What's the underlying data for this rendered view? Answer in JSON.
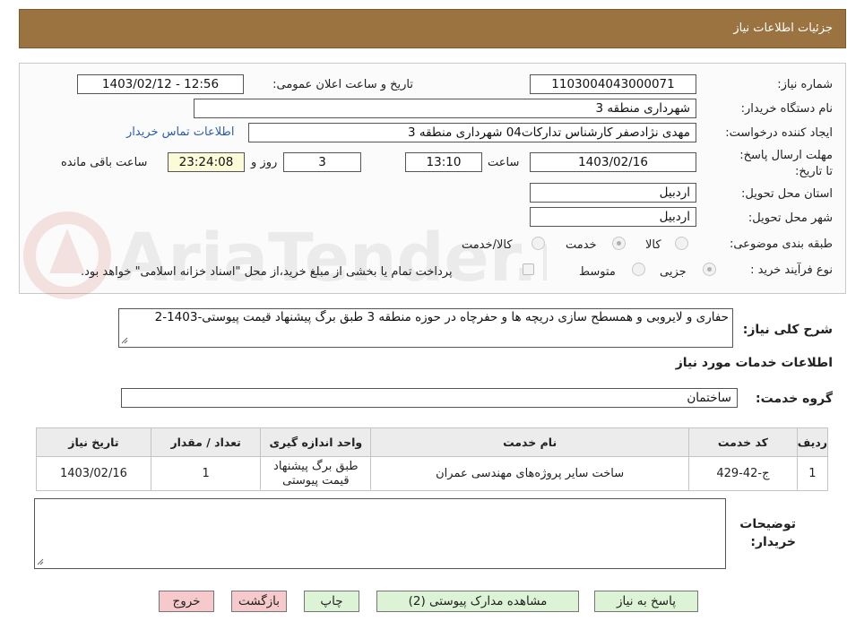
{
  "header": {
    "title": "جزئیات اطلاعات نیاز"
  },
  "fields": {
    "need_number_label": "شماره نیاز:",
    "need_number": "1103004043000071",
    "announce_label": "تاریخ و ساعت اعلان عمومی:",
    "announce_value": "1403/02/12 - 12:56",
    "buyer_org_label": "نام دستگاه خریدار:",
    "buyer_org": "شهرداری منطقه 3",
    "requester_label": "ایجاد کننده درخواست:",
    "requester": "مهدی نژادصفر کارشناس تدارکات04 شهرداری منطقه 3",
    "buyer_contact_link": "اطلاعات تماس خریدار",
    "deadline_label": "مهلت ارسال پاسخ: تا تاریخ:",
    "deadline_date": "1403/02/16",
    "time_label": "ساعت",
    "deadline_time": "13:10",
    "days_value": "3",
    "days_label": "روز و",
    "remaining_time": "23:24:08",
    "remaining_label": "ساعت باقی مانده",
    "province_label": "استان محل تحویل:",
    "province": "اردبیل",
    "city_label": "شهر محل تحویل:",
    "city": "اردبیل",
    "category_label": "طبقه بندی موضوعی:",
    "category_options": [
      "کالا",
      "خدمت",
      "کالا/خدمت"
    ],
    "category_selected": "خدمت",
    "process_label": "نوع فرآیند خرید :",
    "process_options": [
      "جزیی",
      "متوسط"
    ],
    "process_selected": "جزیی",
    "payment_note": "پرداخت تمام یا بخشی از مبلغ خرید،از محل \"اسناد خزانه اسلامی\" خواهد بود.",
    "description_label": "شرح کلی نیاز:",
    "description": "حفاری و لایروبی و همسطح سازی دریچه ها و حفرچاه در حوزه منطقه 3 طبق برگ پیشنهاد قیمت پیوستی-1403-2",
    "services_title": "اطلاعات خدمات مورد نیاز",
    "service_group_label": "گروه خدمت:",
    "service_group": "ساختمان",
    "buyer_notes_label_1": "توضیحات",
    "buyer_notes_label_2": "خریدار:",
    "buyer_notes": ""
  },
  "watermark": {
    "text": "AriaTender.neT"
  },
  "table": {
    "headers": [
      "ردیف",
      "کد خدمت",
      "نام خدمت",
      "واحد اندازه گیری",
      "تعداد / مقدار",
      "تاریخ نیاز"
    ],
    "rows": [
      [
        "1",
        "ج-42-429",
        "ساخت سایر پروژه‌های مهندسی عمران",
        "طبق برگ پیشنهاد قیمت پیوستی",
        "1",
        "1403/02/16"
      ]
    ]
  },
  "buttons": {
    "reply": "پاسخ به نیاز",
    "view_docs": "مشاهده مدارک پیوستی (2)",
    "print": "چاپ",
    "back": "بازگشت",
    "exit": "خروج"
  },
  "colors": {
    "header_bg": "#9a7341",
    "green_button": "#dcf3d6",
    "pink_button": "#f6c9cc",
    "link": "#2a5db0"
  }
}
